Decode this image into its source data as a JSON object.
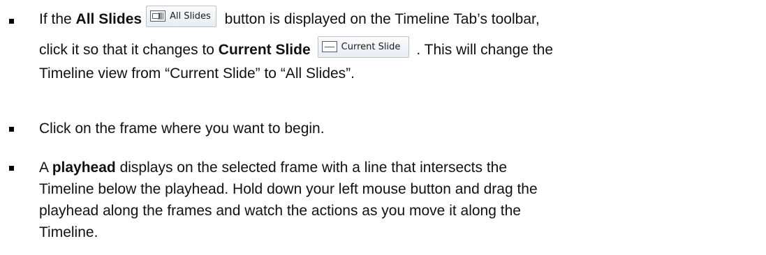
{
  "bullets": [
    {
      "line1_before": "If the ",
      "all_slides_bold": "All Slides",
      "all_slides_button": "All Slides",
      "line1_after": " button is displayed on the Timeline Tab’s toolbar,",
      "line2_before": "click it so that it changes to ",
      "current_slide_bold": "Current Slide",
      "current_slide_button": "Current Slide",
      "line2_after": ". This will change the",
      "line3": "Timeline view from “Current Slide” to “All Slides”."
    },
    {
      "text": "Click on the frame where you want to begin."
    },
    {
      "line1_before": "A ",
      "playhead_bold": "playhead",
      "line1_after": " displays on the selected frame with a line that intersects the",
      "line2": "Timeline below the playhead. Hold down your left mouse button and drag the",
      "line3": "playhead along the frames and watch the actions as you move it along the",
      "line4": "Timeline."
    }
  ],
  "icons": {
    "all_slides": "all-slides-icon",
    "current_slide": "current-slide-icon",
    "bullet": "square-bullet"
  }
}
